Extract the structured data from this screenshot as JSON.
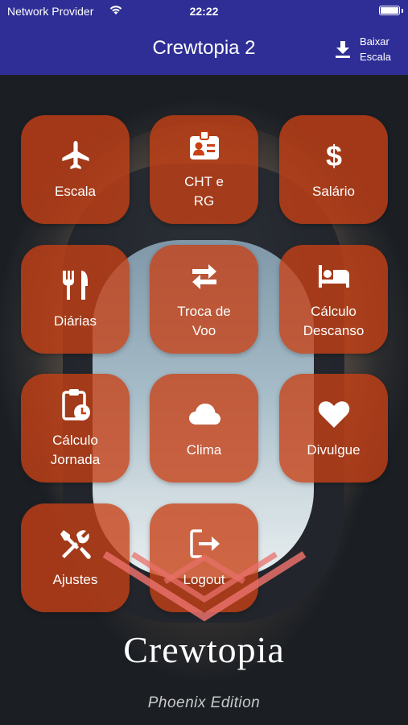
{
  "status_bar": {
    "carrier": "Network Provider",
    "time": "22:22"
  },
  "app_bar": {
    "title": "Crewtopia 2",
    "download_label": "Baixar\nEscala"
  },
  "tiles": [
    {
      "label": "Escala",
      "icon": "airplane-icon"
    },
    {
      "label": "CHT e\nRG",
      "icon": "id-badge-icon"
    },
    {
      "label": "Salário",
      "icon": "dollar-icon"
    },
    {
      "label": "Diárias",
      "icon": "utensils-icon"
    },
    {
      "label": "Troca de\nVoo",
      "icon": "swap-arrows-icon"
    },
    {
      "label": "Cálculo\nDescanso",
      "icon": "bed-icon"
    },
    {
      "label": "Cálculo\nJornada",
      "icon": "clipboard-clock-icon"
    },
    {
      "label": "Clima",
      "icon": "cloud-icon"
    },
    {
      "label": "Divulgue",
      "icon": "heart-icon"
    },
    {
      "label": "Ajustes",
      "icon": "tools-icon"
    },
    {
      "label": "Logout",
      "icon": "logout-icon"
    }
  ],
  "brand": {
    "logo_text": "Crewtopia",
    "edition": "Phoenix Edition"
  },
  "colors": {
    "app_bar": "#2e2e96",
    "tile": "#c84014",
    "emblem": "#e8706a"
  }
}
